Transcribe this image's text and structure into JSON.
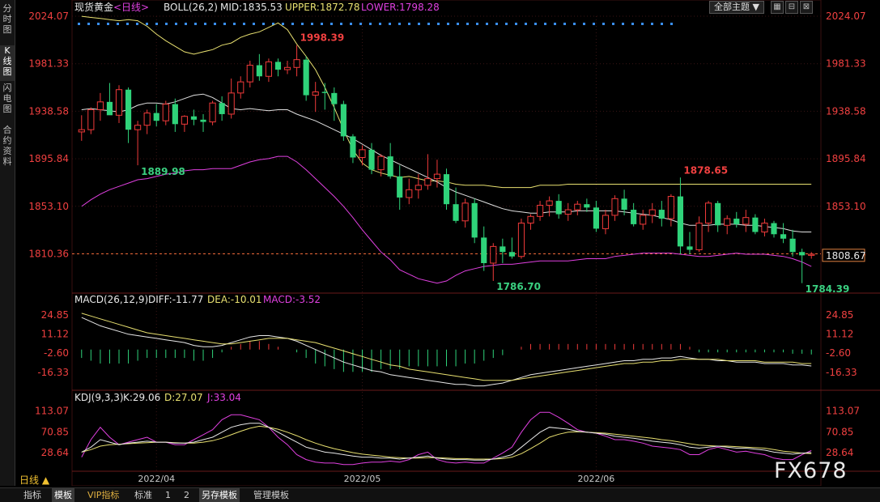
{
  "sidebar": [
    {
      "label": "分时图",
      "active": false
    },
    {
      "label": "K线图",
      "active": true
    },
    {
      "label": "闪电图",
      "active": false
    },
    {
      "label": "合约资料",
      "active": false
    }
  ],
  "main_header": {
    "symbol": "现货黄金",
    "period_tag": "<日线>",
    "indicator": "BOLL(26,2)",
    "mid": "MID:1835.53",
    "upper": "UPPER:1872.78",
    "lower": "LOWER:1798.28"
  },
  "macd_header": {
    "name": "MACD(26,12,9)",
    "diff": "DIFF:-11.77",
    "dea": "DEA:-10.01",
    "macd": "MACD:-3.52"
  },
  "kdj_header": {
    "name": "KDJ(9,3,3)",
    "k": "K:29.06",
    "d": "D:27.07",
    "j": "J:33.04"
  },
  "toolbar": {
    "theme_label": "全部主题",
    "theme_arrow": "▼",
    "btn1": "▦",
    "btn2": "⊟",
    "btn3": "⊠"
  },
  "period_selector": "日线 ▲",
  "bottom_tabs": [
    {
      "label": "指标",
      "active": false,
      "vip": false
    },
    {
      "label": "模板",
      "active": true,
      "vip": false
    },
    {
      "label": "VIP指标",
      "active": false,
      "vip": true
    },
    {
      "label": "标准",
      "active": false,
      "vip": false
    },
    {
      "label": "1",
      "active": false,
      "vip": false
    },
    {
      "label": "2",
      "active": false,
      "vip": false
    },
    {
      "label": "另存模板",
      "active": true,
      "vip": false
    },
    {
      "label": "管理模板",
      "active": false,
      "vip": false
    }
  ],
  "watermark": "FX678",
  "colors": {
    "up": "#f03a3a",
    "down": "#2fd37a",
    "mid": "#e0e0e0",
    "upper": "#e8e070",
    "lower": "#e040e0",
    "diff": "#e8e8e8",
    "dea": "#e8e070",
    "k": "#e8e8e8",
    "d": "#e8e070",
    "j": "#e040e0",
    "axis_price": "#f04040",
    "axis_ind": "#f04040"
  },
  "chart_data": {
    "type": "candlestick",
    "price_axis_ticks": [
      "2024.07",
      "1981.33",
      "1938.58",
      "1895.84",
      "1853.10",
      "1810.36"
    ],
    "price_range": [
      1776.5,
      2024.07
    ],
    "last_price_tag": "1808.67",
    "dashed_price_label": "1810.36",
    "dashed_price": 1810.36,
    "annotations": [
      {
        "text": "1998.39",
        "value": 1998.39,
        "kind": "high"
      },
      {
        "text": "1889.98",
        "value": 1889.98,
        "kind": "low"
      },
      {
        "text": "1878.65",
        "value": 1878.65,
        "kind": "high"
      },
      {
        "text": "1786.70",
        "value": 1786.7,
        "kind": "low"
      },
      {
        "text": "1784.39",
        "value": 1784.39,
        "kind": "low"
      }
    ],
    "x_labels": [
      "2022/04",
      "2022/05",
      "2022/06"
    ],
    "candles": [
      [
        1920,
        1935,
        1912,
        1922
      ],
      [
        1922,
        1942,
        1918,
        1940
      ],
      [
        1940,
        1955,
        1930,
        1947
      ],
      [
        1947,
        1964,
        1938,
        1935
      ],
      [
        1935,
        1962,
        1928,
        1958
      ],
      [
        1958,
        1960,
        1910,
        1922
      ],
      [
        1922,
        1930,
        1890,
        1926
      ],
      [
        1926,
        1940,
        1918,
        1937
      ],
      [
        1937,
        1945,
        1925,
        1930
      ],
      [
        1930,
        1948,
        1926,
        1945
      ],
      [
        1945,
        1950,
        1920,
        1927
      ],
      [
        1927,
        1935,
        1920,
        1934
      ],
      [
        1934,
        1940,
        1926,
        1931
      ],
      [
        1931,
        1936,
        1920,
        1929
      ],
      [
        1929,
        1948,
        1926,
        1946
      ],
      [
        1946,
        1952,
        1930,
        1936
      ],
      [
        1936,
        1968,
        1932,
        1955
      ],
      [
        1955,
        1970,
        1950,
        1965
      ],
      [
        1965,
        1984,
        1960,
        1980
      ],
      [
        1980,
        1990,
        1966,
        1970
      ],
      [
        1970,
        1986,
        1965,
        1983
      ],
      [
        1983,
        1986,
        1970,
        1976
      ],
      [
        1976,
        1984,
        1972,
        1978
      ],
      [
        1978,
        1998,
        1970,
        1985
      ],
      [
        1985,
        1988,
        1948,
        1953
      ],
      [
        1953,
        1965,
        1938,
        1956
      ],
      [
        1956,
        1964,
        1940,
        1955
      ],
      [
        1955,
        1960,
        1930,
        1945
      ],
      [
        1945,
        1948,
        1912,
        1916
      ],
      [
        1916,
        1918,
        1892,
        1897
      ],
      [
        1897,
        1908,
        1890,
        1904
      ],
      [
        1904,
        1910,
        1882,
        1886
      ],
      [
        1886,
        1900,
        1880,
        1898
      ],
      [
        1898,
        1910,
        1878,
        1880
      ],
      [
        1880,
        1890,
        1850,
        1861
      ],
      [
        1861,
        1878,
        1855,
        1868
      ],
      [
        1868,
        1882,
        1860,
        1872
      ],
      [
        1872,
        1900,
        1868,
        1878
      ],
      [
        1878,
        1895,
        1870,
        1882
      ],
      [
        1882,
        1887,
        1850,
        1855
      ],
      [
        1855,
        1870,
        1838,
        1840
      ],
      [
        1840,
        1860,
        1834,
        1856
      ],
      [
        1856,
        1860,
        1820,
        1825
      ],
      [
        1825,
        1835,
        1795,
        1802
      ],
      [
        1802,
        1820,
        1786,
        1817
      ],
      [
        1817,
        1824,
        1802,
        1812
      ],
      [
        1812,
        1825,
        1806,
        1808
      ],
      [
        1808,
        1842,
        1806,
        1838
      ],
      [
        1838,
        1846,
        1832,
        1844
      ],
      [
        1844,
        1858,
        1840,
        1854
      ],
      [
        1854,
        1862,
        1844,
        1858
      ],
      [
        1858,
        1864,
        1842,
        1846
      ],
      [
        1846,
        1856,
        1840,
        1850
      ],
      [
        1850,
        1858,
        1845,
        1855
      ],
      [
        1855,
        1860,
        1848,
        1852
      ],
      [
        1852,
        1858,
        1830,
        1833
      ],
      [
        1833,
        1850,
        1828,
        1845
      ],
      [
        1845,
        1863,
        1840,
        1860
      ],
      [
        1860,
        1868,
        1845,
        1850
      ],
      [
        1850,
        1856,
        1835,
        1837
      ],
      [
        1837,
        1850,
        1832,
        1845
      ],
      [
        1845,
        1856,
        1838,
        1850
      ],
      [
        1850,
        1858,
        1835,
        1842
      ],
      [
        1842,
        1864,
        1835,
        1862
      ],
      [
        1862,
        1879,
        1810,
        1817
      ],
      [
        1817,
        1830,
        1810,
        1814
      ],
      [
        1814,
        1844,
        1812,
        1838
      ],
      [
        1838,
        1858,
        1830,
        1856
      ],
      [
        1856,
        1858,
        1830,
        1836
      ],
      [
        1836,
        1845,
        1828,
        1842
      ],
      [
        1842,
        1848,
        1834,
        1837
      ],
      [
        1837,
        1850,
        1830,
        1843
      ],
      [
        1843,
        1846,
        1828,
        1830
      ],
      [
        1830,
        1842,
        1826,
        1838
      ],
      [
        1838,
        1840,
        1825,
        1828
      ],
      [
        1828,
        1838,
        1820,
        1824
      ],
      [
        1824,
        1832,
        1808,
        1812
      ],
      [
        1812,
        1815,
        1784,
        1809
      ],
      [
        1809,
        1812,
        1806,
        1810
      ]
    ],
    "boll_mid": [
      1940,
      1941,
      1940,
      1939,
      1938,
      1940,
      1944,
      1946,
      1946,
      1945,
      1947,
      1950,
      1953,
      1954,
      1951,
      1946,
      1941,
      1940,
      1941,
      1940,
      1939,
      1940,
      1940,
      1936,
      1933,
      1930,
      1926,
      1922,
      1918,
      1914,
      1909,
      1904,
      1899,
      1895,
      1891,
      1887,
      1883,
      1879,
      1875,
      1870,
      1866,
      1863,
      1860,
      1857,
      1854,
      1851,
      1849,
      1848,
      1847,
      1847,
      1848,
      1848,
      1848,
      1849,
      1849,
      1849,
      1849,
      1849,
      1848,
      1847,
      1846,
      1845,
      1843,
      1841,
      1838,
      1836,
      1836,
      1836,
      1837,
      1837,
      1837,
      1836,
      1836,
      1835,
      1834,
      1833,
      1831,
      1830,
      1830
    ],
    "boll_upper": [
      2024,
      2023,
      2022,
      2021,
      2020,
      2021,
      2020,
      2015,
      2008,
      2002,
      1997,
      1992,
      1990,
      1992,
      1994,
      1998,
      2000,
      2005,
      2008,
      2010,
      2014,
      2018,
      2012,
      1999,
      1988,
      1976,
      1960,
      1942,
      1922,
      1904,
      1892,
      1886,
      1883,
      1881,
      1879,
      1880,
      1878,
      1876,
      1876,
      1875,
      1873,
      1872,
      1872,
      1872,
      1871,
      1870,
      1870,
      1870,
      1870,
      1872,
      1872,
      1872,
      1873,
      1873,
      1873,
      1873,
      1873,
      1873,
      1873,
      1873,
      1873,
      1873,
      1873,
      1873,
      1873,
      1873,
      1873,
      1873,
      1873,
      1873,
      1873,
      1873,
      1873,
      1873,
      1873,
      1873,
      1873,
      1873,
      1873
    ],
    "boll_lower": [
      1853,
      1859,
      1864,
      1868,
      1871,
      1874,
      1877,
      1878,
      1880,
      1882,
      1883,
      1885,
      1886,
      1886,
      1887,
      1887,
      1887,
      1890,
      1893,
      1895,
      1896,
      1898,
      1898,
      1893,
      1886,
      1878,
      1870,
      1862,
      1853,
      1843,
      1832,
      1822,
      1812,
      1805,
      1796,
      1792,
      1788,
      1786,
      1784,
      1786,
      1791,
      1795,
      1797,
      1799,
      1800,
      1801,
      1801,
      1802,
      1803,
      1804,
      1804,
      1804,
      1804,
      1805,
      1806,
      1806,
      1806,
      1808,
      1809,
      1810,
      1811,
      1811,
      1811,
      1811,
      1810,
      1809,
      1808,
      1808,
      1809,
      1810,
      1811,
      1810,
      1810,
      1810,
      1809,
      1808,
      1806,
      1803,
      1799
    ],
    "macd_axis_ticks": [
      "24.85",
      "11.12",
      "-2.60",
      "-16.33"
    ],
    "macd_range": [
      -28,
      30
    ],
    "macd_diff": [
      23,
      20,
      17,
      15,
      13,
      11,
      10,
      9,
      8,
      7,
      6,
      5,
      3,
      2,
      2,
      3,
      5,
      7,
      9,
      10,
      10,
      9,
      8,
      6,
      3,
      0,
      -3,
      -6,
      -9,
      -11,
      -13,
      -15,
      -16,
      -18,
      -19,
      -20,
      -21,
      -22,
      -23,
      -24,
      -25,
      -25,
      -26,
      -26,
      -25,
      -24,
      -22,
      -20,
      -18,
      -17,
      -16,
      -15,
      -14,
      -13,
      -12,
      -11,
      -10,
      -9,
      -8,
      -8,
      -7,
      -7,
      -6,
      -6,
      -5,
      -6,
      -7,
      -7,
      -8,
      -8,
      -9,
      -9,
      -9,
      -10,
      -10,
      -10,
      -11,
      -11,
      -11.77
    ],
    "macd_dea": [
      26,
      24,
      22,
      20,
      18,
      16,
      14,
      12,
      11,
      10,
      9,
      8,
      7,
      6,
      5,
      4,
      4,
      5,
      6,
      7,
      8,
      8,
      8,
      7,
      6,
      5,
      3,
      1,
      -1,
      -3,
      -5,
      -7,
      -9,
      -11,
      -12,
      -14,
      -15,
      -16,
      -17,
      -18,
      -19,
      -20,
      -21,
      -22,
      -22,
      -22,
      -22,
      -21,
      -20,
      -19,
      -18,
      -17,
      -16,
      -15,
      -14,
      -13,
      -12,
      -11,
      -10,
      -10,
      -9,
      -9,
      -8,
      -8,
      -7,
      -7,
      -7,
      -7,
      -7,
      -8,
      -8,
      -8,
      -8,
      -9,
      -9,
      -9,
      -9,
      -10,
      -10.01
    ],
    "macd_bars": [
      -6,
      -8,
      -10,
      -10,
      -10,
      -10,
      -8,
      -6,
      -6,
      -6,
      -6,
      -6,
      -8,
      -8,
      -6,
      -2,
      2,
      4,
      6,
      6,
      4,
      2,
      0,
      -2,
      -6,
      -10,
      -12,
      -14,
      -16,
      -16,
      -16,
      -16,
      -14,
      -14,
      -14,
      -12,
      -12,
      -12,
      -12,
      -12,
      -12,
      -10,
      -10,
      -8,
      -6,
      -4,
      0,
      2,
      4,
      4,
      4,
      4,
      4,
      4,
      4,
      4,
      4,
      4,
      4,
      4,
      4,
      4,
      4,
      4,
      4,
      2,
      -2,
      -2,
      -2,
      -2,
      -2,
      -2,
      -2,
      -2,
      -2,
      -2,
      -3,
      -3,
      -3.52
    ],
    "kdj_axis_ticks": [
      "113.07",
      "70.85",
      "28.64"
    ],
    "kdj_range": [
      -10,
      125
    ],
    "kdj_k": [
      30,
      40,
      55,
      50,
      45,
      48,
      50,
      52,
      50,
      50,
      48,
      48,
      50,
      55,
      60,
      70,
      80,
      85,
      88,
      88,
      80,
      70,
      60,
      50,
      40,
      35,
      30,
      28,
      25,
      22,
      20,
      20,
      18,
      18,
      16,
      18,
      20,
      22,
      18,
      16,
      15,
      15,
      14,
      14,
      16,
      20,
      25,
      40,
      55,
      70,
      80,
      78,
      76,
      72,
      70,
      68,
      66,
      62,
      60,
      58,
      55,
      52,
      50,
      48,
      45,
      40,
      38,
      40,
      42,
      40,
      38,
      38,
      36,
      34,
      30,
      28,
      26,
      28,
      29.06
    ],
    "kdj_d": [
      30,
      35,
      42,
      45,
      46,
      47,
      48,
      49,
      50,
      50,
      49,
      48,
      48,
      50,
      53,
      58,
      65,
      72,
      78,
      82,
      80,
      76,
      70,
      63,
      55,
      48,
      42,
      37,
      33,
      29,
      26,
      24,
      22,
      20,
      19,
      18,
      18,
      19,
      19,
      18,
      17,
      17,
      16,
      16,
      16,
      17,
      20,
      27,
      37,
      48,
      60,
      66,
      70,
      71,
      70,
      69,
      68,
      66,
      64,
      62,
      60,
      58,
      55,
      53,
      50,
      47,
      44,
      43,
      42,
      42,
      41,
      40,
      39,
      38,
      35,
      32,
      30,
      28,
      27.07
    ],
    "kdj_j": [
      20,
      55,
      80,
      60,
      45,
      50,
      55,
      60,
      50,
      50,
      45,
      45,
      55,
      65,
      75,
      95,
      105,
      105,
      100,
      95,
      80,
      60,
      45,
      25,
      15,
      10,
      8,
      8,
      5,
      5,
      8,
      10,
      10,
      12,
      10,
      15,
      25,
      30,
      15,
      10,
      8,
      10,
      8,
      8,
      18,
      28,
      40,
      70,
      95,
      110,
      110,
      100,
      88,
      75,
      70,
      68,
      62,
      55,
      55,
      52,
      48,
      42,
      40,
      38,
      35,
      25,
      25,
      35,
      40,
      35,
      30,
      32,
      28,
      25,
      18,
      15,
      15,
      25,
      33.04
    ]
  }
}
